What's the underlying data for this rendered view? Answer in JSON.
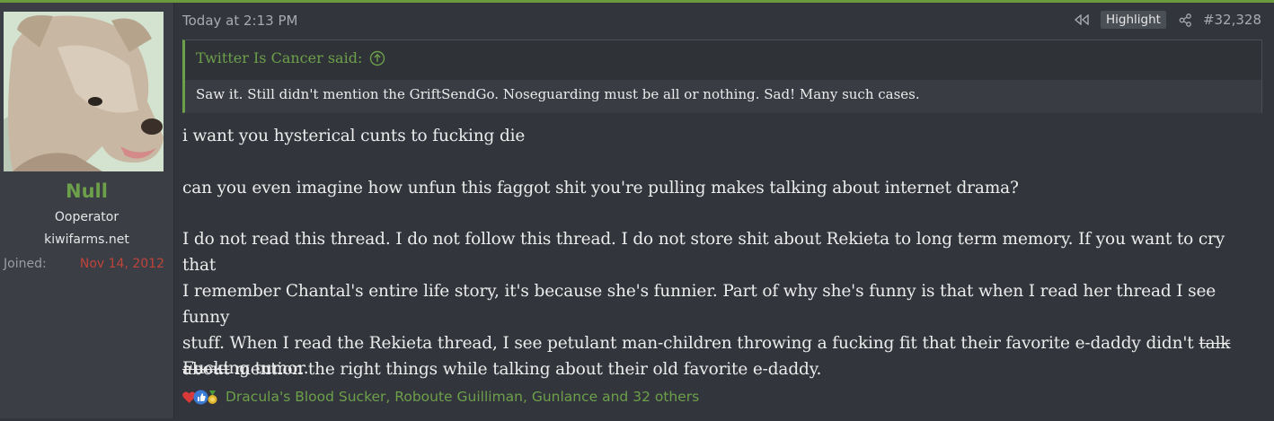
{
  "user": {
    "name": "Null",
    "title": "Ooperator",
    "site": "kiwifarms.net",
    "joined_label": "Joined:",
    "joined_date": "Nov 14, 2012"
  },
  "post": {
    "timestamp": "Today at 2:13 PM",
    "highlight_label": "Highlight",
    "post_number": "#32,328",
    "quote": {
      "author": "Twitter Is Cancer said:",
      "text": "Saw it. Still didn't mention the GriftSendGo. Noseguarding must be all or nothing. Sad! Many such cases."
    },
    "paragraphs": {
      "p1": "i want you hysterical cunts to fucking die",
      "p2": "can you even imagine how unfun this faggot shit you're pulling makes talking about internet drama?",
      "p3_line1": "I do not read this thread. I do not follow this thread. I do not store shit about Rekieta to long term memory. If you want to cry that",
      "p3_line2": "I remember Chantal's entire life story, it's because she's funnier. Part of why she's funny is that when I read her thread I see funny",
      "p3_line3_a": "stuff. When I read the Rekieta thread, I see petulant man-children throwing a fucking fit that their favorite e-daddy didn't ",
      "p3_line3_strike": "talk",
      "p3_line4_strike": "about",
      "p3_line4_b": " mention the right things while talking about their old favorite e-daddy.",
      "p4": "Fucking tumor."
    },
    "reactions": {
      "icons": [
        "heart-icon",
        "thumbs-up-icon",
        "award-icon"
      ],
      "users": "Dracula's Blood Sucker, Roboute Guilliman, Gunlance and 32 others"
    }
  },
  "colors": {
    "accent_green": "#6da04a",
    "joined_red": "#c0433a",
    "background": "#32353b",
    "sidebar": "#3b3f45"
  }
}
